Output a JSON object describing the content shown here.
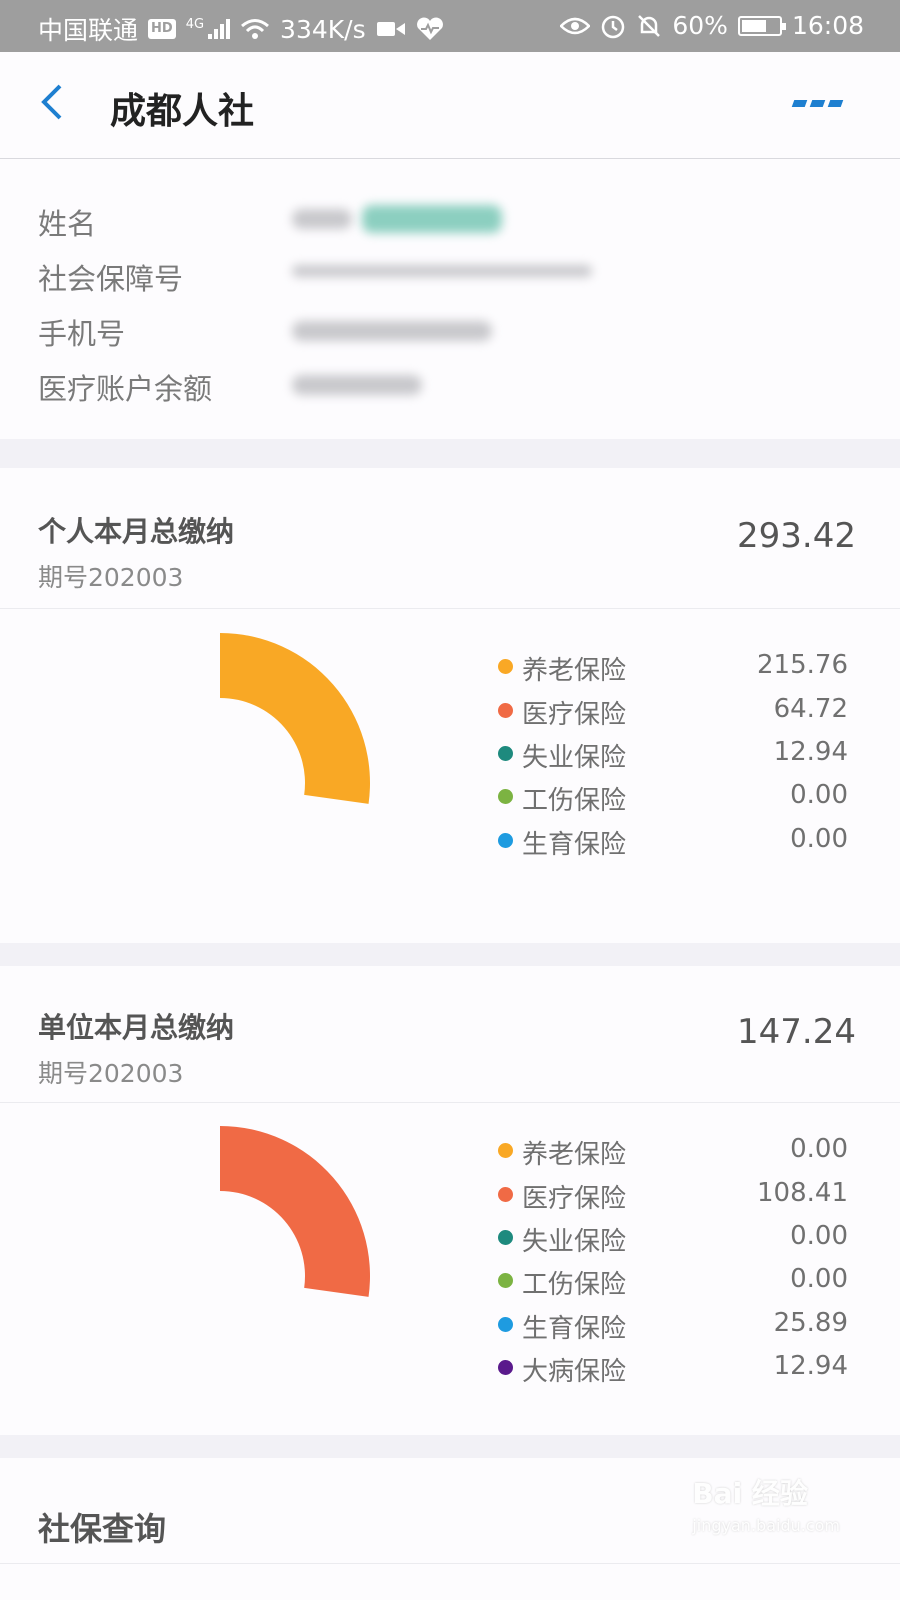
{
  "status_bar": {
    "carrier": "中国联通",
    "hd_badge": "HD",
    "network": "4G",
    "speed": "334K/s",
    "battery": "60%",
    "time": "16:08"
  },
  "nav": {
    "title": "成都人社",
    "back_icon": "chevron-left-icon",
    "more_icon": "more-dots-icon"
  },
  "info": {
    "rows": [
      {
        "label": "姓名"
      },
      {
        "label": "社会保障号"
      },
      {
        "label": "手机号"
      },
      {
        "label": "医疗账户余额"
      }
    ]
  },
  "personal": {
    "title": "个人本月总缴纳",
    "period": "期号202003",
    "total": "293.42"
  },
  "company": {
    "title": "单位本月总缴纳",
    "period": "期号202003",
    "total": "147.24"
  },
  "query": {
    "title": "社保查询"
  },
  "watermark": {
    "text": "Bai 经验",
    "sub": "jingyan.baidu.com"
  },
  "colors": {
    "pension": "#f9a825",
    "medical": "#f06a45",
    "unemployment": "#1e8a7e",
    "injury": "#7cb342",
    "maternity": "#1e9be0",
    "serious_illness": "#5a1a8c"
  },
  "chart_data": [
    {
      "type": "pie",
      "categories": [
        "养老保险",
        "医疗保险",
        "失业保险",
        "工伤保险",
        "生育保险"
      ],
      "values": [
        215.76,
        64.72,
        12.94,
        0.0,
        0.0
      ],
      "labels": [
        "215.76",
        "64.72",
        "12.94",
        "0.00",
        "0.00"
      ],
      "colors": [
        "#f9a825",
        "#f06a45",
        "#1e8a7e",
        "#7cb342",
        "#1e9be0"
      ],
      "visible_sector": {
        "category": "养老保险",
        "start_deg": 0,
        "end_deg": 98
      },
      "legend": "right"
    },
    {
      "type": "pie",
      "categories": [
        "养老保险",
        "医疗保险",
        "失业保险",
        "工伤保险",
        "生育保险",
        "大病保险"
      ],
      "values": [
        0.0,
        108.41,
        0.0,
        0.0,
        25.89,
        12.94
      ],
      "labels": [
        "0.00",
        "108.41",
        "0.00",
        "0.00",
        "25.89",
        "12.94"
      ],
      "colors": [
        "#f9a825",
        "#f06a45",
        "#1e8a7e",
        "#7cb342",
        "#1e9be0",
        "#5a1a8c"
      ],
      "visible_sector": {
        "category": "医疗保险",
        "start_deg": 0,
        "end_deg": 98
      },
      "legend": "right"
    }
  ]
}
